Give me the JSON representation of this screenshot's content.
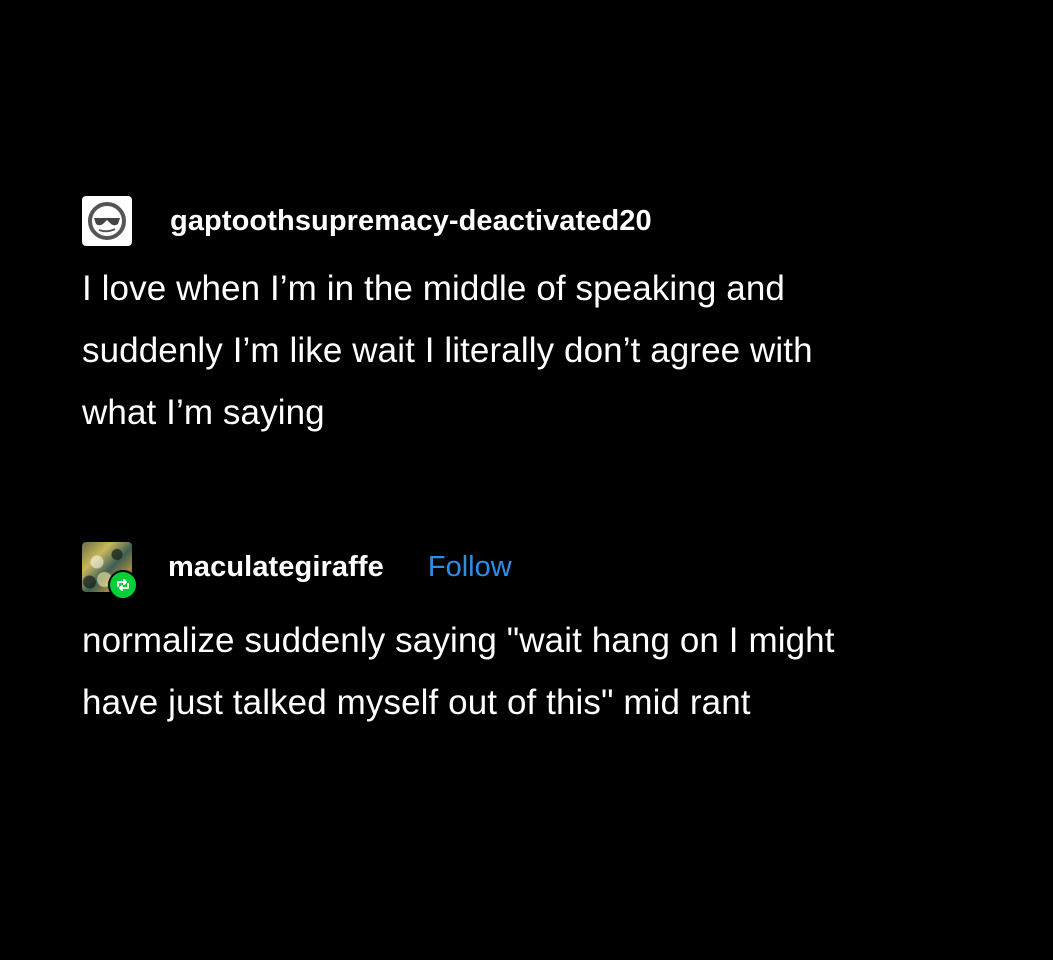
{
  "posts": [
    {
      "username": "gaptoothsupremacy-deactivated20",
      "avatar_icon": "sunglasses-face-icon",
      "body_lines": [
        "I love when I’m in the middle of speaking and",
        "suddenly I’m like wait I literally don’t agree with",
        "what I’m saying"
      ]
    },
    {
      "username": "maculategiraffe",
      "follow_label": "Follow",
      "badge_icon": "reblog-icon",
      "body_lines": [
        "normalize suddenly saying \"wait hang on I might",
        "have just talked myself out of this\" mid rant"
      ]
    }
  ],
  "colors": {
    "background": "#000000",
    "text": "#ffffff",
    "follow": "#2f8ce6",
    "reblog_badge": "#00cf35"
  }
}
